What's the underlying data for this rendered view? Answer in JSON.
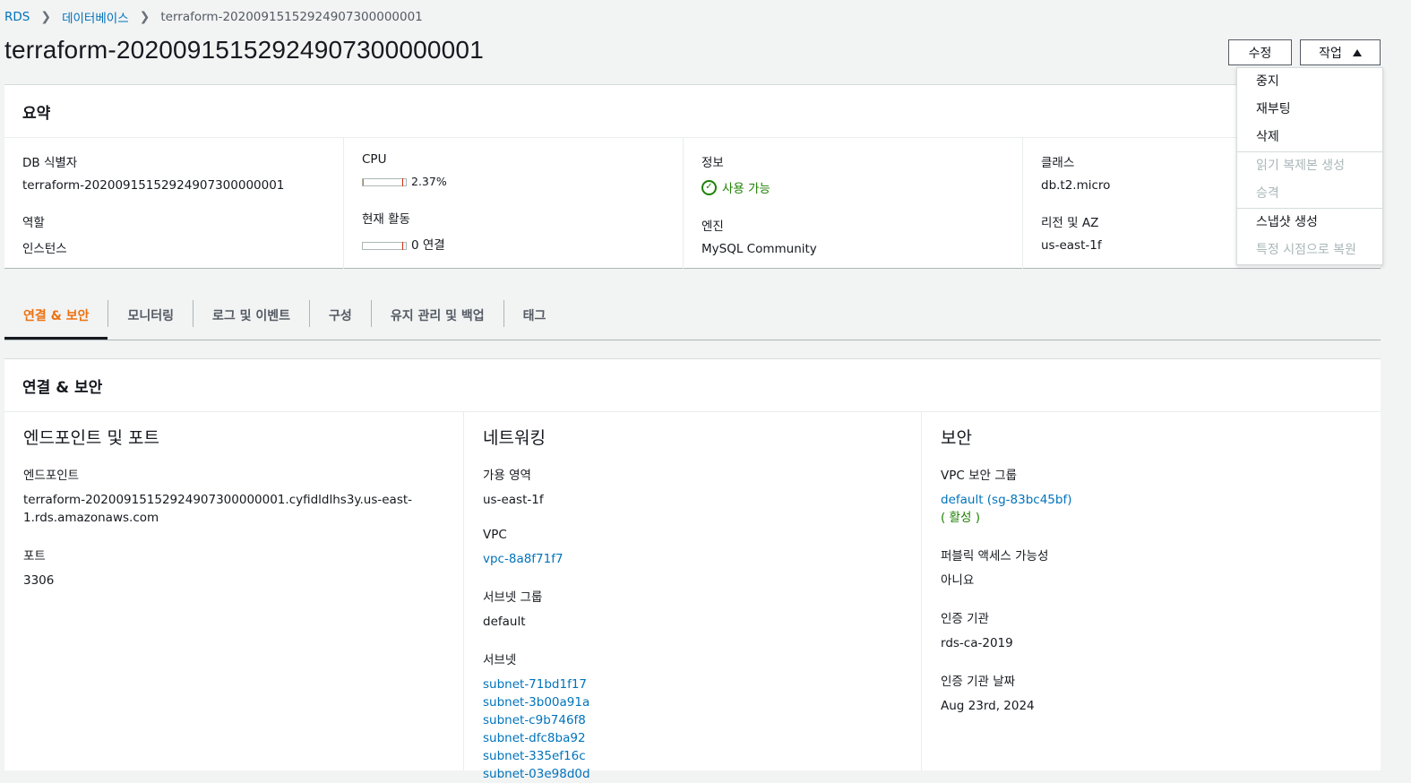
{
  "breadcrumb": {
    "root": "RDS",
    "databases": "데이터베이스",
    "current": "terraform-20200915152924907300000001"
  },
  "page_title": "terraform-20200915152924907300000001",
  "buttons": {
    "modify": "수정",
    "actions": "작업"
  },
  "actions_menu": {
    "stop": "중지",
    "reboot": "재부팅",
    "delete": "삭제",
    "create_read_replica": "읽기 복제본 생성",
    "promote": "승격",
    "take_snapshot": "스냅샷 생성",
    "restore_point_in_time": "특정 시점으로 복원"
  },
  "summary": {
    "title": "요약",
    "db_identifier_label": "DB 식별자",
    "db_identifier": "terraform-20200915152924907300000001",
    "role_label": "역할",
    "role": "인스턴스",
    "cpu_label": "CPU",
    "cpu_value": "2.37%",
    "cpu_fraction": 0.0237,
    "activity_label": "현재 활동",
    "activity_value": "0 연결",
    "status_label": "정보",
    "status_value": "사용 가능",
    "engine_label": "엔진",
    "engine": "MySQL Community",
    "class_label": "클래스",
    "class": "db.t2.micro",
    "region_label": "리전 및 AZ",
    "region": "us-east-1f"
  },
  "tabs": [
    "연결 & 보안",
    "모니터링",
    "로그 및 이벤트",
    "구성",
    "유지 관리 및 백업",
    "태그"
  ],
  "connectivity": {
    "title": "연결 & 보안",
    "endpoint_section": "엔드포인트 및 포트",
    "endpoint_label": "엔드포인트",
    "endpoint_line1": "terraform-20200915152924907300000001.cyfidldlhs3y.us-east-",
    "endpoint_line2": "1.rds.amazonaws.com",
    "port_label": "포트",
    "port": "3306",
    "networking_section": "네트워킹",
    "az_label": "가용 영역",
    "az": "us-east-1f",
    "vpc_label": "VPC",
    "vpc": "vpc-8a8f71f7",
    "subnet_group_label": "서브넷 그룹",
    "subnet_group": "default",
    "subnets_label": "서브넷",
    "subnets": [
      "subnet-71bd1f17",
      "subnet-3b00a91a",
      "subnet-c9b746f8",
      "subnet-dfc8ba92",
      "subnet-335ef16c",
      "subnet-03e98d0d"
    ],
    "security_section": "보안",
    "sg_label": "VPC 보안 그룹",
    "sg": "default (sg-83bc45bf)",
    "sg_status": "( 활성 )",
    "public_label": "퍼블릭 액세스 가능성",
    "public": "아니요",
    "ca_label": "인증 기관",
    "ca": "rds-ca-2019",
    "ca_date_label": "인증 기관 날짜",
    "ca_date": "Aug 23rd, 2024"
  },
  "colors": {
    "link": "#0073bb",
    "active_tab": "#ec7211",
    "success": "#1d8102"
  }
}
